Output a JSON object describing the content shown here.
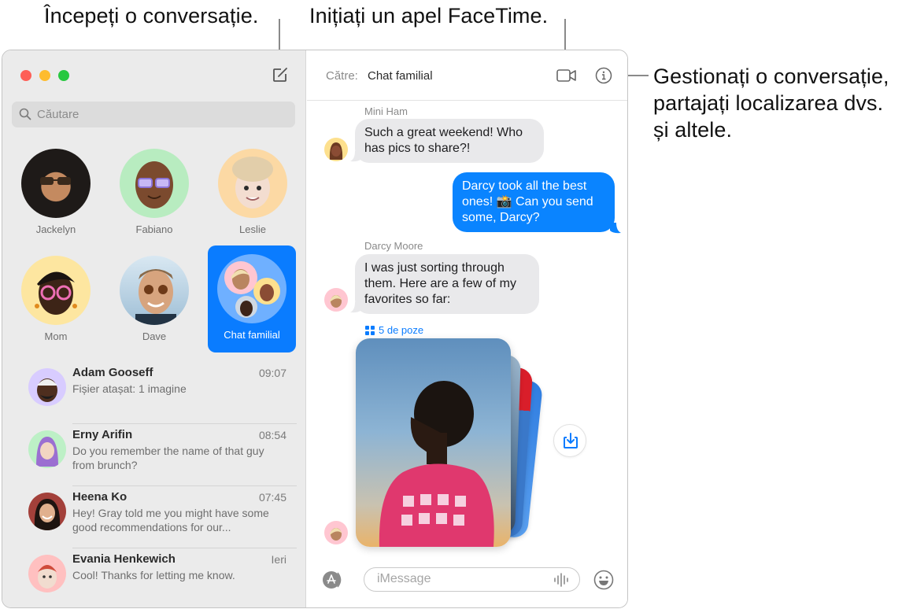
{
  "callouts": {
    "new_conversation": "Începeți o conversație.",
    "facetime": "Inițiați un apel FaceTime.",
    "manage": [
      "Gestionați o conversație,",
      "partajați localizarea dvs.",
      "și altele."
    ]
  },
  "sidebar": {
    "search_placeholder": "Căutare",
    "pinned": [
      {
        "name": "Jackelyn",
        "bg": "#2b2b2b"
      },
      {
        "name": "Fabiano",
        "bg": "#b8ecc0"
      },
      {
        "name": "Leslie",
        "bg": "#fcd9a4"
      },
      {
        "name": "Mom",
        "bg": "#fde6a0"
      },
      {
        "name": "Dave",
        "bg": "#c9dff0"
      },
      {
        "name": "Chat familial",
        "bg": "#6fb0ff",
        "selected": true
      }
    ],
    "conversations": [
      {
        "name": "Adam Gooseff",
        "time": "09:07",
        "preview": "Fișier atașat:  1 imagine",
        "bg": "#d8ccff"
      },
      {
        "name": "Erny Arifin",
        "time": "08:54",
        "preview": "Do you remember the name of that guy from brunch?",
        "bg": "#bdf0c6"
      },
      {
        "name": "Heena Ko",
        "time": "07:45",
        "preview": "Hey! Gray told me you might have some good recommendations for our...",
        "bg": "#a3403a"
      },
      {
        "name": "Evania Henkewich",
        "time": "Ieri",
        "preview": "Cool! Thanks for letting me know.",
        "bg": "#ffc0c0"
      }
    ]
  },
  "chat": {
    "to_label": "Către:",
    "to_value": "Chat familial",
    "messages": [
      {
        "sender": "Mini Ham",
        "text": "Such a great weekend! Who has pics to share?!",
        "direction": "in"
      },
      {
        "text": "Darcy took all the best ones! 📸 Can you send some, Darcy?",
        "direction": "out"
      },
      {
        "sender": "Darcy Moore",
        "text": "I was just sorting through them. Here are a few of my favorites so far:",
        "direction": "in"
      }
    ],
    "photos_label": "5 de poze",
    "photo_count": 5,
    "input_placeholder": "iMessage"
  },
  "colors": {
    "accent": "#0a7cff",
    "bubble_out": "#0a84ff",
    "bubble_in": "#e9e9eb",
    "close": "#fe5f57",
    "minimize": "#febc2e",
    "zoom": "#28c840"
  }
}
